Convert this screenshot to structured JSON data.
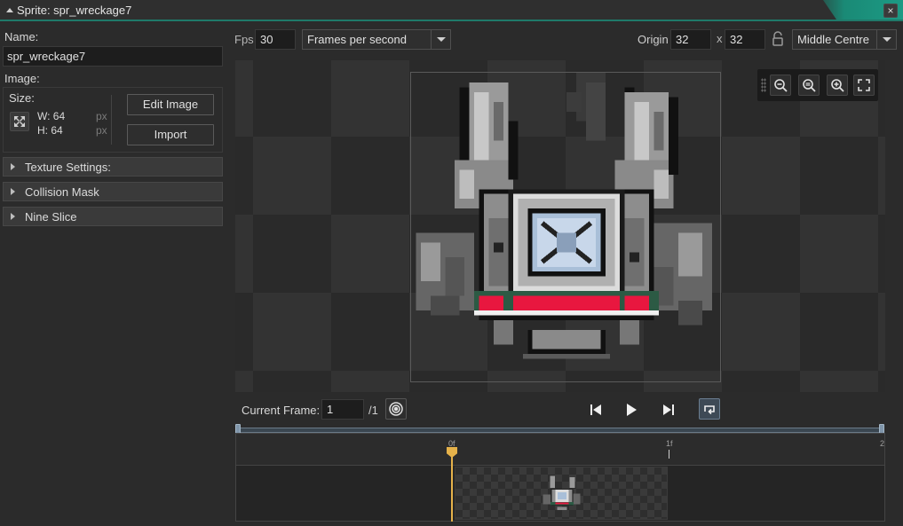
{
  "window": {
    "title": "Sprite: spr_wreckage7"
  },
  "left_panel": {
    "name_label": "Name:",
    "name_value": "spr_wreckage7",
    "image_label": "Image:",
    "size_label": "Size:",
    "width_text": "W: 64",
    "height_text": "H: 64",
    "unit": "px",
    "edit_image_label": "Edit Image",
    "import_label": "Import",
    "sections": [
      {
        "label": "Texture Settings:"
      },
      {
        "label": "Collision Mask"
      },
      {
        "label": "Nine Slice"
      }
    ]
  },
  "toolbar": {
    "fps_label": "Fps",
    "fps_value": "30",
    "fps_mode": "Frames per second",
    "origin_label": "Origin",
    "origin_x": "32",
    "origin_sep": "x",
    "origin_y": "32",
    "origin_preset": "Middle Centre"
  },
  "playback": {
    "current_frame_label": "Current Frame:",
    "current_frame_value": "1",
    "frame_total": "/1"
  },
  "timeline": {
    "ticks": [
      "0f",
      "1f",
      "2"
    ]
  },
  "icons": {
    "collapse": "triangle-up-icon",
    "close": "close-icon",
    "resize": "resize-icon",
    "lock": "lock-open-icon",
    "zoom_out": "zoom-out-icon",
    "zoom_reset": "zoom-reset-icon",
    "zoom_in": "zoom-in-icon",
    "fit": "fullscreen-icon",
    "onion": "onion-skin-icon",
    "prev": "skip-back-icon",
    "play": "play-icon",
    "next": "skip-forward-icon",
    "loop": "loop-icon"
  },
  "colors": {
    "accent": "#1c9a84",
    "playhead": "#e6b24a",
    "sprite_red": "#e8173f",
    "sprite_green": "#2c5a44"
  }
}
